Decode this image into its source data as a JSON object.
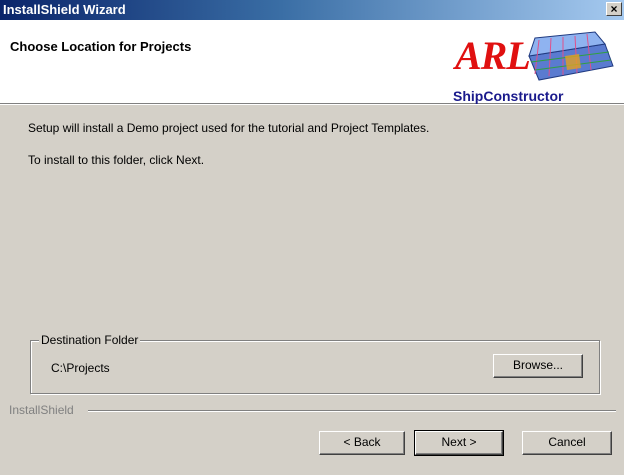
{
  "window": {
    "title": "InstallShield Wizard",
    "close_label": "×"
  },
  "header": {
    "title": "Choose Location for Projects",
    "logo": {
      "text": "ARL",
      "brand": "ShipConstructor",
      "accent": "#e01010",
      "brand_color": "#1a1a8c"
    }
  },
  "body": {
    "line1": "Setup will install a Demo project used for the tutorial and Project Templates.",
    "line2": "To install to this folder, click Next."
  },
  "destination": {
    "group_label": "Destination Folder",
    "path": "C:\\Projects",
    "browse_label": "Browse..."
  },
  "footer": {
    "brand_label": "InstallShield",
    "back_label": "< Back",
    "next_label": "Next >",
    "cancel_label": "Cancel"
  }
}
